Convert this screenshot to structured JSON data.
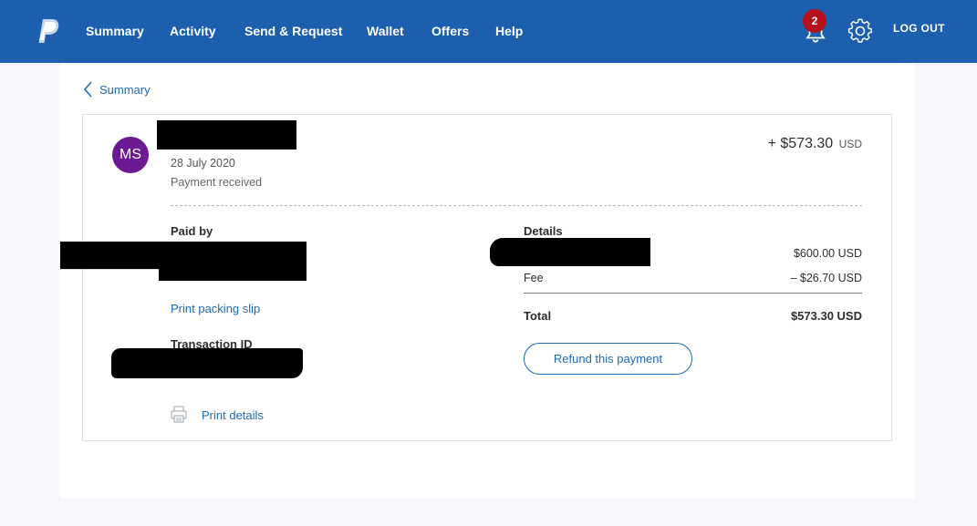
{
  "header": {
    "nav": [
      "Summary",
      "Activity",
      "Send & Request",
      "Wallet",
      "Offers",
      "Help"
    ],
    "notification_count": "2",
    "logout_label": "LOG OUT"
  },
  "back_link": "Summary",
  "transaction": {
    "avatar_initials": "MS",
    "date": "28 July 2020",
    "status": "Payment received",
    "amount": "+ $573.30",
    "currency": "USD"
  },
  "paid_by": {
    "heading": "Paid by",
    "print_packing_slip": "Print packing slip"
  },
  "transaction_id": {
    "heading": "Transaction ID"
  },
  "print_details": "Print details",
  "details": {
    "heading": "Details",
    "rows": [
      {
        "label": "",
        "value": "$600.00 USD"
      },
      {
        "label": "Fee",
        "value": "– $26.70 USD"
      }
    ],
    "total_label": "Total",
    "total_value": "$573.30 USD"
  },
  "refund_button": "Refund this payment",
  "colors": {
    "brand_blue": "#1b5fae",
    "link_blue": "#1c6ab2",
    "avatar_purple": "#6b1a91",
    "badge_red": "#b3111b"
  }
}
